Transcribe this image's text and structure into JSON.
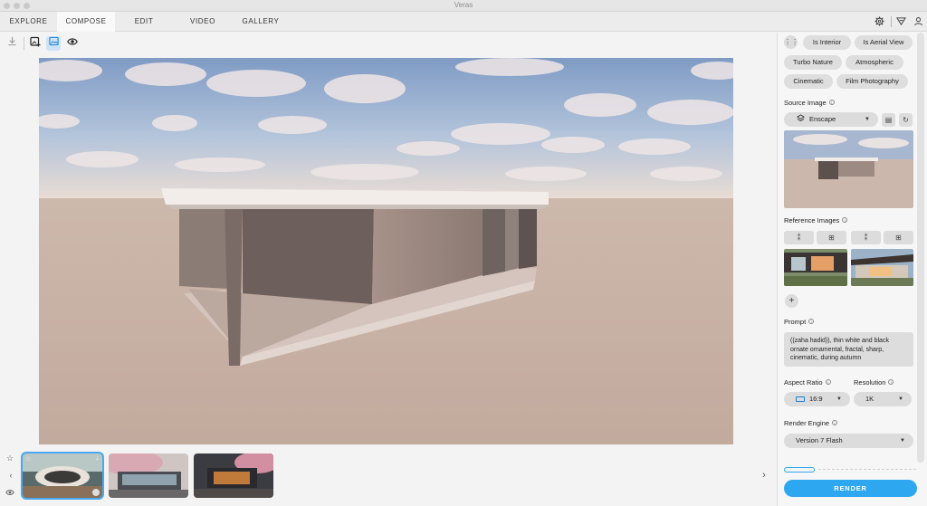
{
  "app": {
    "title": "Veras"
  },
  "tabs": [
    {
      "label": "EXPLORE",
      "active": false
    },
    {
      "label": "COMPOSE",
      "active": true
    },
    {
      "label": "EDIT",
      "active": false
    },
    {
      "label": "VIDEO",
      "active": false
    },
    {
      "label": "GALLERY",
      "active": false
    }
  ],
  "header_icons": [
    "gear-icon",
    "filter-icon",
    "user-icon"
  ],
  "toolbar": {
    "icons": [
      "download-icon",
      "add-image-icon",
      "image-icon",
      "eye-icon"
    ],
    "active": "image-icon"
  },
  "filmstrip": {
    "thumbnail_count": 3,
    "selected_index": 0
  },
  "panel": {
    "chips": [
      "Is Interior",
      "Is Aerial View",
      "Turbo Nature",
      "Atmospheric",
      "Cinematic",
      "Film Photography"
    ],
    "source_image": {
      "label": "Source Image",
      "source": "Enscape"
    },
    "reference_images": {
      "label": "Reference Images",
      "add_label": "+"
    },
    "prompt": {
      "label": "Prompt",
      "value": "((zaha hadid)), thin white and black ornate ornamental, fractal, sharp, cinematic, during autumn"
    },
    "aspect_ratio": {
      "label": "Aspect Ratio",
      "value": "16:9"
    },
    "resolution": {
      "label": "Resolution",
      "value": "1K"
    },
    "render_engine": {
      "label": "Render Engine",
      "value": "Version 7 Flash"
    },
    "render_button": "RENDER"
  },
  "colors": {
    "accent": "#2ea7f1",
    "selection": "#4aa8ef"
  }
}
